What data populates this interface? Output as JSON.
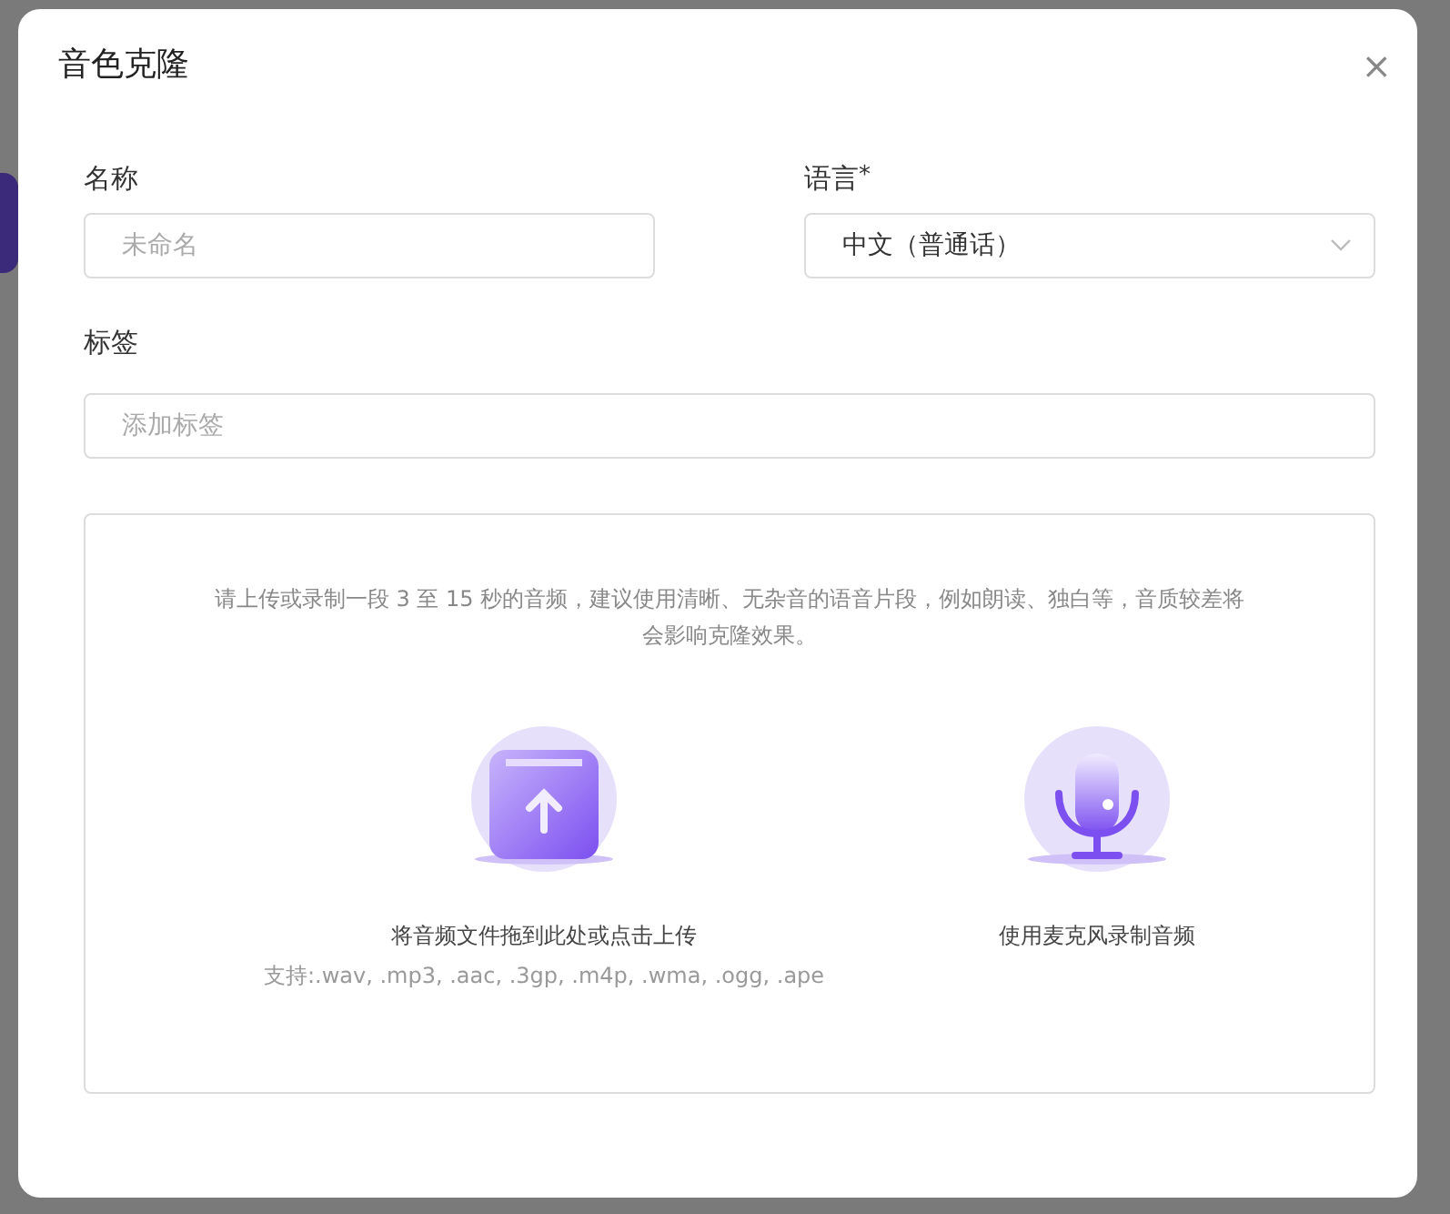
{
  "dialog": {
    "title": "音色克隆",
    "close": "×"
  },
  "fields": [
    {
      "label": "名称",
      "kind": "text",
      "placeholder": "未命名"
    },
    {
      "label": "语言",
      "required_mark": "*",
      "kind": "select",
      "value": "中文（普通话）"
    }
  ],
  "tags": {
    "label": "标签",
    "placeholder": "添加标签"
  },
  "upload": {
    "hint": "请上传或录制一段 3 至 15 秒的音频，建议使用清晰、无杂音的语音片段，例如朗读、独白等，音质较差将会影响克隆效果。",
    "options": [
      {
        "kind": "file",
        "title": "将音频文件拖到此处或点击上传",
        "note": "支持:.wav, .mp3, .aac, .3gp, .m4p, .wma, .ogg, .ape"
      },
      {
        "kind": "mic",
        "title": "使用麦克风录制音频"
      }
    ]
  }
}
